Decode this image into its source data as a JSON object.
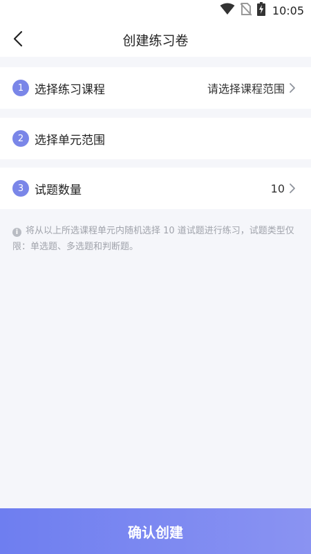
{
  "status": {
    "time": "10:05",
    "icons": [
      "wifi-icon",
      "no-sim-icon",
      "battery-charging-icon"
    ]
  },
  "nav": {
    "title": "创建练习卷",
    "back_icon": "chevron-left-icon"
  },
  "steps": [
    {
      "num": "1",
      "label": "选择练习课程",
      "value": "请选择课程范围"
    },
    {
      "num": "2",
      "label": "选择单元范围",
      "value": ""
    },
    {
      "num": "3",
      "label": "试题数量",
      "value": "10"
    }
  ],
  "note": {
    "icon": "info-icon",
    "text": "将从以上所选课程单元内随机选择 10 道试题进行练习，试题类型仅限：单选题、多选题和判断题。"
  },
  "confirm": {
    "label": "确认创建"
  },
  "colors": {
    "accent": "#7a86e8",
    "button_gradient_start": "#6e7ef0",
    "button_gradient_end": "#8a93f2",
    "background": "#f5f6fa"
  }
}
